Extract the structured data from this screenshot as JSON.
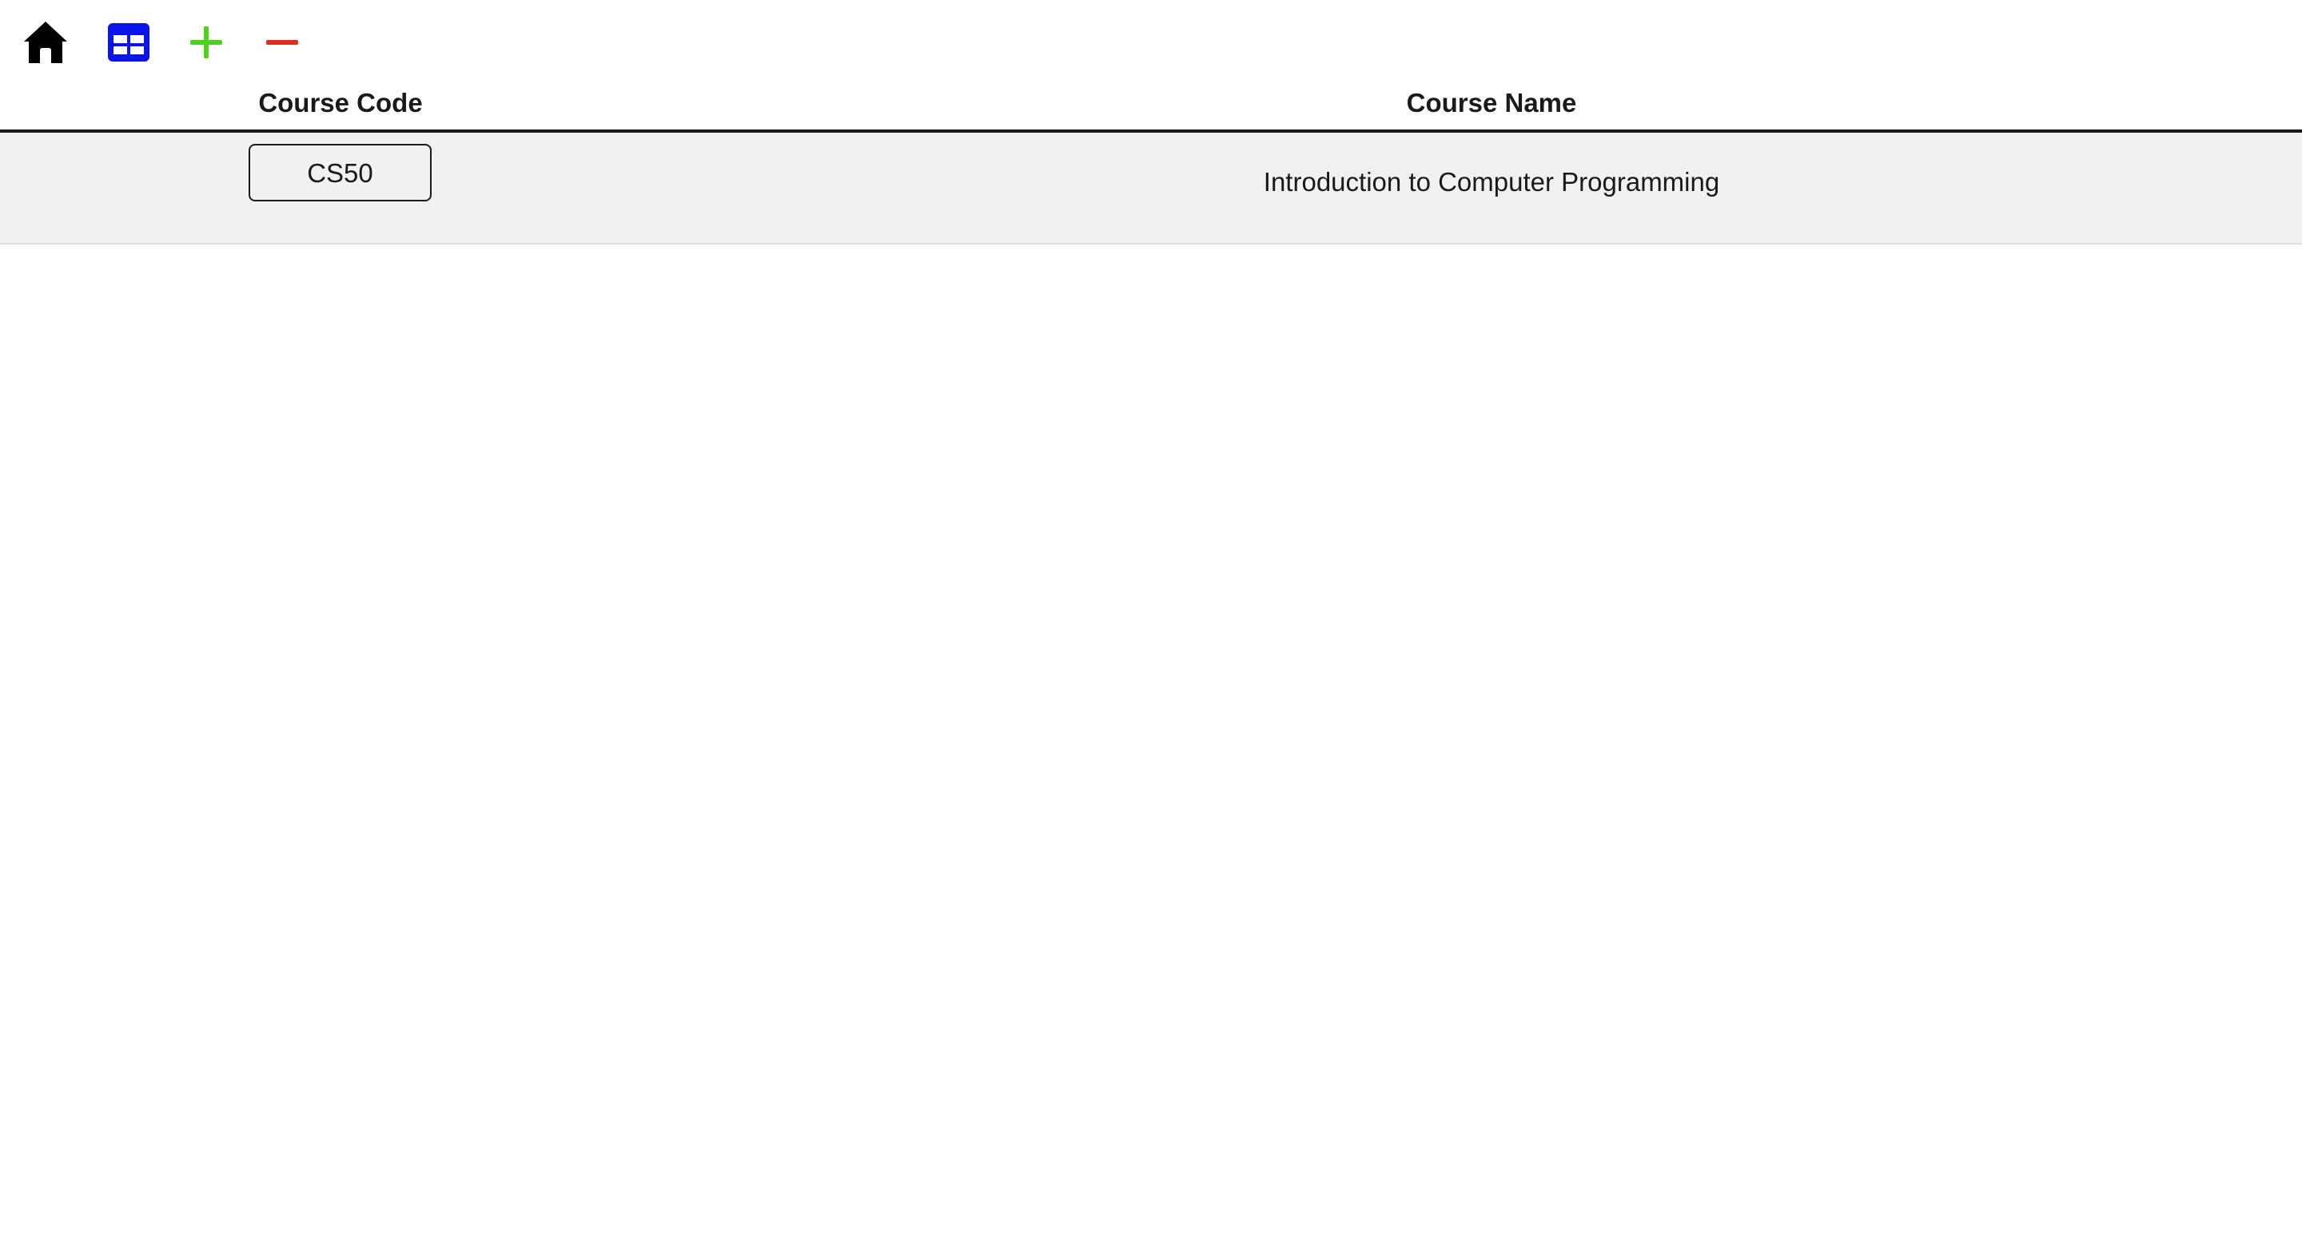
{
  "toolbar": {
    "icons": [
      "home-icon",
      "table-icon",
      "plus-icon",
      "minus-icon"
    ],
    "colors": {
      "home": "#000000",
      "table": "#0a14e6",
      "add": "#4cd11f",
      "remove": "#e02d1f"
    }
  },
  "table": {
    "columns": [
      "Course Code",
      "Course Name"
    ],
    "rows": [
      {
        "code": "CS50",
        "name": "Introduction to Computer Programming"
      }
    ]
  },
  "colors": {
    "row_background": "#f1f1f1",
    "header_rule": "#1a1a1a",
    "text": "#1a1a1a"
  }
}
